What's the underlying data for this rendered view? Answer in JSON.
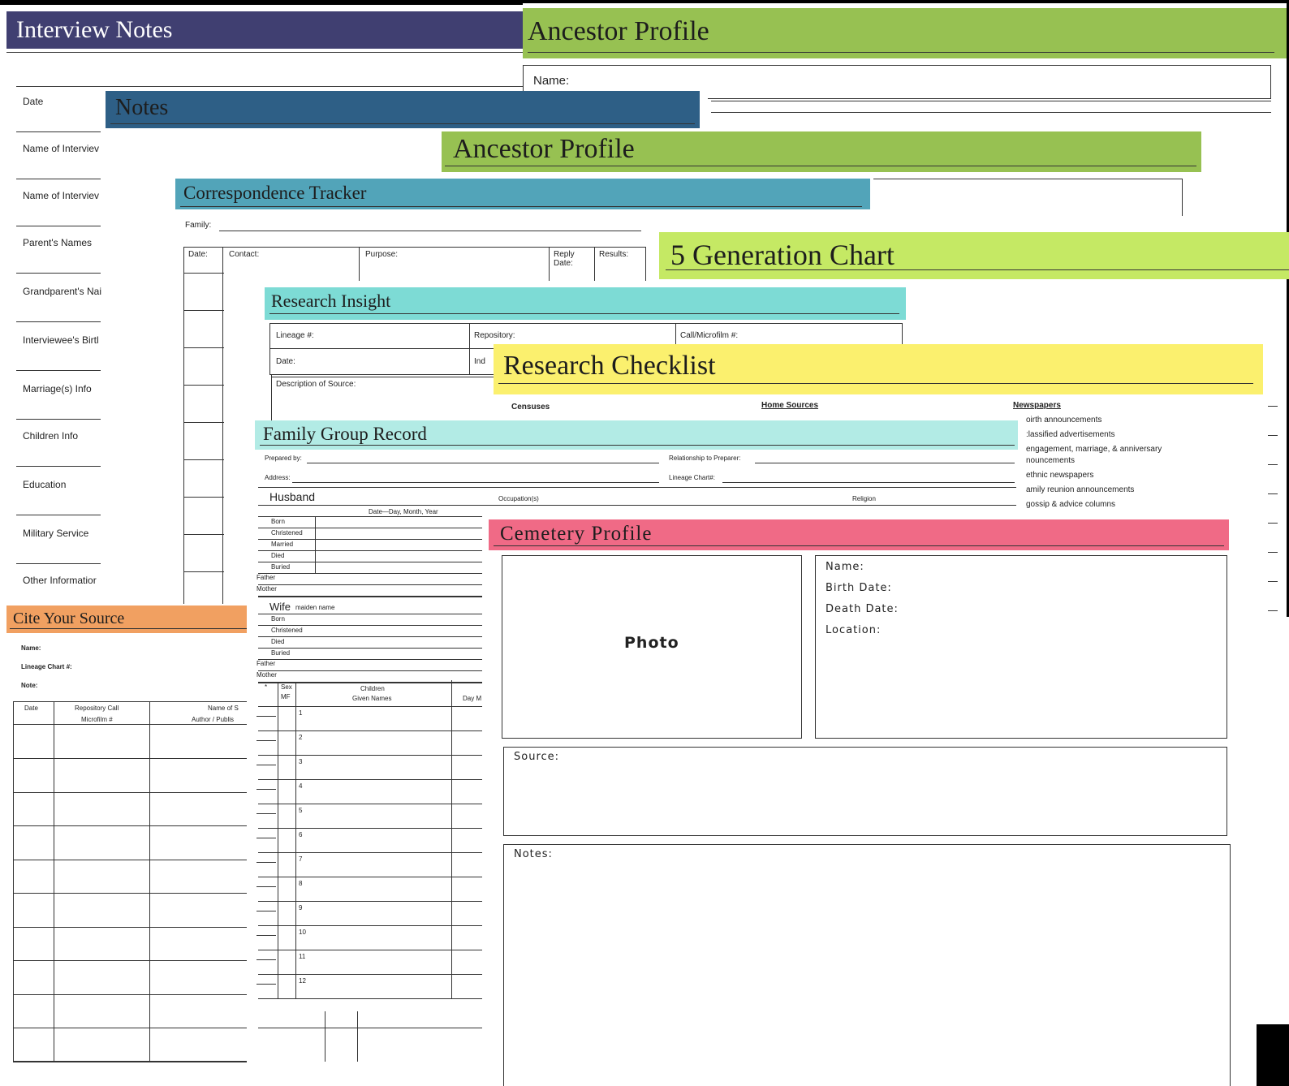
{
  "interview_notes": {
    "title": "Interview Notes",
    "fields": [
      "Date",
      "Name of Interviev",
      "Name of Interviev",
      "Parent's Names",
      "Grandparent's Nai",
      "Interviewee's Birtl",
      "Marriage(s) Info",
      "Children Info",
      "Education",
      "Military Service",
      "Other Informatior"
    ]
  },
  "ancestor_profile_back": {
    "title": "Ancestor Profile",
    "name_label": "Name:"
  },
  "notes": {
    "title": "Notes"
  },
  "ancestor_profile_mid": {
    "title": "Ancestor Profile"
  },
  "correspondence": {
    "title": "Correspondence Tracker",
    "family_label": "Family:",
    "columns": [
      "Date:",
      "Contact:",
      "Purpose:",
      "Reply Date:",
      "Results:"
    ]
  },
  "generation": {
    "title": "5 Generation Chart"
  },
  "research_insight": {
    "title": "Research Insight",
    "lineage_label": "Lineage #:",
    "repository_label": "Repository:",
    "call_label": "Call/Microfilm #:",
    "date_label": "Date:",
    "ind_label": "Ind",
    "description_label": "Description of Source:"
  },
  "checklist": {
    "title": "Research Checklist",
    "headers": [
      "Censuses",
      "Home Sources",
      "Newspapers"
    ],
    "newspaper_items": [
      "oirth announcements",
      ":lassified advertisements",
      "engagement, marriage, & anniversary",
      "nouncements",
      "ethnic newspapers",
      "amily reunion announcements",
      "gossip & advice columns"
    ]
  },
  "family_group": {
    "title": "Family Group Record",
    "prepared_label": "Prepared by:",
    "relationship_label": "Relationship to Preparer:",
    "address_label": "Address:",
    "lineage_label": "Lineage Chart#:",
    "husband_label": "Husband",
    "occupation_label": "Occupation(s)",
    "religion_label": "Religion",
    "date_header": "Date—Day, Month, Year",
    "husband_events": [
      "Born",
      "Christened",
      "Married",
      "Died",
      "Buried"
    ],
    "father_label": "Father",
    "mother_label": "Mother",
    "wife_label": "Wife",
    "maiden_label": "maiden name",
    "wife_events": [
      "Born",
      "Christened",
      "Died",
      "Buried"
    ],
    "star_label": "*",
    "sex_label": "Sex",
    "mf_label": "MF",
    "children_label": "Children",
    "given_label": "Given Names",
    "day_label": "Day M",
    "child_numbers": [
      "1",
      "2",
      "3",
      "4",
      "5",
      "6",
      "7",
      "8",
      "9",
      "10",
      "11",
      "12"
    ]
  },
  "cite_source": {
    "title": "Cite Your Source",
    "name_label": "Name:",
    "lineage_label": "Lineage Chart #:",
    "note_label": "Note:",
    "col_date": "Date",
    "col_repo_1": "Repository Call",
    "col_repo_2": "Microfilm #",
    "col_name_1": "Name of S",
    "col_name_2": "Author / Publis"
  },
  "cemetery": {
    "title": "Cemetery Profile",
    "photo_label": "Photo",
    "name_label": "Name:",
    "birth_label": "Birth Date:",
    "death_label": "Death Date:",
    "location_label": "Location:",
    "source_label": "Source:",
    "notes_label": "Notes:"
  },
  "colors": {
    "interview": "#403f71",
    "ancestor": "#97c152",
    "notes": "#2e5f86",
    "correspondence": "#52a4b9",
    "generation": "#c5e964",
    "insight": "#7ddbd5",
    "checklist": "#fbf06e",
    "family": "#b2ebe5",
    "cite": "#f1a061",
    "cemetery": "#f06a86"
  }
}
